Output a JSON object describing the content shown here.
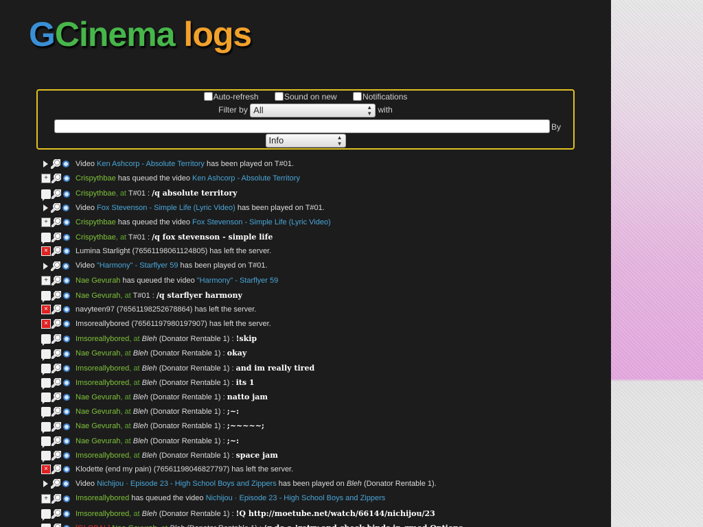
{
  "logo": {
    "p1": "G",
    "p2": "Cinema",
    "p3": " logs"
  },
  "options": {
    "auto_refresh": "Auto-refresh",
    "sound_on_new": "Sound on new",
    "notifications": "Notifications"
  },
  "filter": {
    "label": "Filter by",
    "value": "All",
    "with_label": "with",
    "search_value": "",
    "by_label": "By",
    "type_value": "Info"
  },
  "log": [
    {
      "icon": "play",
      "segments": [
        {
          "t": "Video "
        },
        {
          "t": "Ken Ashcorp - Absolute Territory",
          "c": "blue"
        },
        {
          "t": " has been played on T#01."
        }
      ]
    },
    {
      "icon": "queue",
      "segments": [
        {
          "t": "Crispythbae",
          "c": "green"
        },
        {
          "t": " has queued the video "
        },
        {
          "t": "Ken Ashcorp - Absolute Territory",
          "c": "blue"
        }
      ]
    },
    {
      "icon": "chat",
      "segments": [
        {
          "t": "Crispythbae",
          "c": "green"
        },
        {
          "t": ", at ",
          "c": "atg"
        },
        {
          "t": "T#01 : "
        },
        {
          "t": "/q absolute territory",
          "c": "msg"
        }
      ]
    },
    {
      "icon": "play",
      "segments": [
        {
          "t": "Video "
        },
        {
          "t": "Fox Stevenson - Simple Life (Lyric Video)",
          "c": "blue"
        },
        {
          "t": " has been played on T#01."
        }
      ]
    },
    {
      "icon": "queue",
      "segments": [
        {
          "t": "Crispythbae",
          "c": "green"
        },
        {
          "t": " has queued the video "
        },
        {
          "t": "Fox Stevenson - Simple Life (Lyric Video)",
          "c": "blue"
        }
      ]
    },
    {
      "icon": "chat",
      "segments": [
        {
          "t": "Crispythbae",
          "c": "green"
        },
        {
          "t": ", at ",
          "c": "atg"
        },
        {
          "t": "T#01 : "
        },
        {
          "t": "/q fox stevenson - simple life",
          "c": "msg"
        }
      ]
    },
    {
      "icon": "leave",
      "segments": [
        {
          "t": "Lumina Starlight (76561198061124805) has left the server."
        }
      ]
    },
    {
      "icon": "play",
      "segments": [
        {
          "t": "Video "
        },
        {
          "t": "\"Harmony\" - Starflyer 59",
          "c": "blue"
        },
        {
          "t": " has been played on T#01."
        }
      ]
    },
    {
      "icon": "queue",
      "segments": [
        {
          "t": "Nae Gevurah",
          "c": "green"
        },
        {
          "t": " has queued the video "
        },
        {
          "t": "\"Harmony\" - Starflyer 59",
          "c": "blue"
        }
      ]
    },
    {
      "icon": "chat",
      "segments": [
        {
          "t": "Nae Gevurah",
          "c": "green"
        },
        {
          "t": ", at ",
          "c": "atg"
        },
        {
          "t": "T#01 : "
        },
        {
          "t": "/q starflyer harmony",
          "c": "msg"
        }
      ]
    },
    {
      "icon": "leave",
      "segments": [
        {
          "t": "navyteen97 (76561198252678864) has left the server."
        }
      ]
    },
    {
      "icon": "leave",
      "segments": [
        {
          "t": "Imsoreallybored (76561197980197907) has left the server."
        }
      ]
    },
    {
      "icon": "chat",
      "segments": [
        {
          "t": "Imsoreallybored",
          "c": "green"
        },
        {
          "t": ", at ",
          "c": "atg"
        },
        {
          "t": "Bleh",
          "c": "it"
        },
        {
          "t": " (Donator Rentable 1) : "
        },
        {
          "t": "!skip",
          "c": "msg"
        }
      ]
    },
    {
      "icon": "chat",
      "segments": [
        {
          "t": "Nae Gevurah",
          "c": "green"
        },
        {
          "t": ", at ",
          "c": "atg"
        },
        {
          "t": "Bleh",
          "c": "it"
        },
        {
          "t": " (Donator Rentable 1) : "
        },
        {
          "t": "okay",
          "c": "msg"
        }
      ]
    },
    {
      "icon": "chat",
      "segments": [
        {
          "t": "Imsoreallybored",
          "c": "green"
        },
        {
          "t": ", at ",
          "c": "atg"
        },
        {
          "t": "Bleh",
          "c": "it"
        },
        {
          "t": " (Donator Rentable 1) : "
        },
        {
          "t": "and im really tired",
          "c": "msg"
        }
      ]
    },
    {
      "icon": "chat",
      "segments": [
        {
          "t": "Imsoreallybored",
          "c": "green"
        },
        {
          "t": ", at ",
          "c": "atg"
        },
        {
          "t": "Bleh",
          "c": "it"
        },
        {
          "t": " (Donator Rentable 1) : "
        },
        {
          "t": "its 1",
          "c": "msg"
        }
      ]
    },
    {
      "icon": "chat",
      "segments": [
        {
          "t": "Nae Gevurah",
          "c": "green"
        },
        {
          "t": ", at ",
          "c": "atg"
        },
        {
          "t": "Bleh",
          "c": "it"
        },
        {
          "t": " (Donator Rentable 1) : "
        },
        {
          "t": "natto jam",
          "c": "msg"
        }
      ]
    },
    {
      "icon": "chat",
      "segments": [
        {
          "t": "Nae Gevurah",
          "c": "green"
        },
        {
          "t": ", at ",
          "c": "atg"
        },
        {
          "t": "Bleh",
          "c": "it"
        },
        {
          "t": " (Donator Rentable 1) : "
        },
        {
          "t": ";~:",
          "c": "msg"
        }
      ]
    },
    {
      "icon": "chat",
      "segments": [
        {
          "t": "Nae Gevurah",
          "c": "green"
        },
        {
          "t": ", at ",
          "c": "atg"
        },
        {
          "t": "Bleh",
          "c": "it"
        },
        {
          "t": " (Donator Rentable 1) : "
        },
        {
          "t": ";~~~~~;",
          "c": "msg"
        }
      ]
    },
    {
      "icon": "chat",
      "segments": [
        {
          "t": "Nae Gevurah",
          "c": "green"
        },
        {
          "t": ", at ",
          "c": "atg"
        },
        {
          "t": "Bleh",
          "c": "it"
        },
        {
          "t": " (Donator Rentable 1) : "
        },
        {
          "t": ";~:",
          "c": "msg"
        }
      ]
    },
    {
      "icon": "chat",
      "segments": [
        {
          "t": "Imsoreallybored",
          "c": "green"
        },
        {
          "t": ", at ",
          "c": "atg"
        },
        {
          "t": "Bleh",
          "c": "it"
        },
        {
          "t": " (Donator Rentable 1) : "
        },
        {
          "t": "space jam",
          "c": "msg"
        }
      ]
    },
    {
      "icon": "leave",
      "segments": [
        {
          "t": "Klodette (end my pain) (76561198046827797) has left the server."
        }
      ]
    },
    {
      "icon": "play",
      "segments": [
        {
          "t": "Video "
        },
        {
          "t": "Nichijou · Episode 23 - High School Boys and Zippers",
          "c": "blue"
        },
        {
          "t": " has been played on "
        },
        {
          "t": "Bleh",
          "c": "it"
        },
        {
          "t": " (Donator Rentable 1)."
        }
      ]
    },
    {
      "icon": "queue",
      "segments": [
        {
          "t": "Imsoreallybored",
          "c": "green"
        },
        {
          "t": " has queued the video "
        },
        {
          "t": "Nichijou · Episode 23 - High School Boys and Zippers",
          "c": "blue"
        }
      ]
    },
    {
      "icon": "chat",
      "segments": [
        {
          "t": "Imsoreallybored",
          "c": "green"
        },
        {
          "t": ", at ",
          "c": "atg"
        },
        {
          "t": "Bleh",
          "c": "it"
        },
        {
          "t": " (Donator Rentable 1) : "
        },
        {
          "t": "!Q http://moetube.net/watch/66144/nichijou/23",
          "c": "msg"
        }
      ]
    },
    {
      "icon": "chat",
      "segments": [
        {
          "t": "[GLOBAL] ",
          "c": "red"
        },
        {
          "t": "Nae Gevurah",
          "c": "green"
        },
        {
          "t": ", at ",
          "c": "atg"
        },
        {
          "t": "Bleh",
          "c": "it"
        },
        {
          "t": " (Donator Rentable 1) : "
        },
        {
          "t": "/q do a !retry and check binds in gmod Options",
          "c": "msg"
        }
      ]
    }
  ]
}
